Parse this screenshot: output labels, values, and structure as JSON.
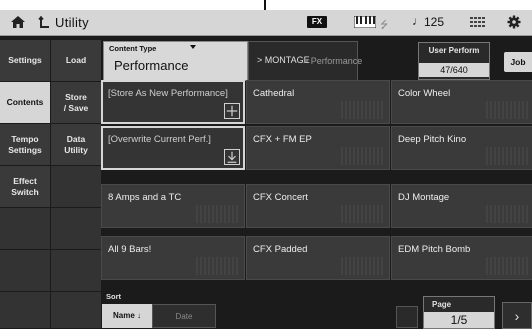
{
  "topbar": {
    "title": "Utility",
    "fx_label": "FX",
    "note_symbol": "♩",
    "tempo": "125"
  },
  "nav": [
    {
      "label": "Settings",
      "active": false
    },
    {
      "label": "Load",
      "active": false
    },
    {
      "label": "Contents",
      "active": true
    },
    {
      "label": "Store\n/ Save",
      "active": false
    },
    {
      "label": "Tempo\nSettings",
      "active": false
    },
    {
      "label": "Data\nUtility",
      "active": false
    },
    {
      "label": "Effect\nSwitch",
      "active": false
    }
  ],
  "content_type": {
    "label": "Content Type",
    "value": "Performance"
  },
  "breadcrumb": {
    "source": "> MONTAGE",
    "target": "> Performance"
  },
  "user_perform": {
    "label": "User Perform",
    "count": "47/640"
  },
  "job_label": "Job",
  "items": [
    [
      "[Store As New Performance]",
      "Cathedral",
      "Color Wheel"
    ],
    [
      "[Overwrite Current Perf.]",
      "CFX + FM EP",
      "Deep Pitch Kino"
    ],
    [
      "8 Amps and a TC",
      "CFX Concert",
      "DJ Montage"
    ],
    [
      "All 9 Bars!",
      "CFX Padded",
      "EDM Pitch Bomb"
    ]
  ],
  "sort": {
    "label": "Sort",
    "name_label": "Name ↓",
    "date_label": "Date"
  },
  "page": {
    "label": "Page",
    "value": "1/5"
  },
  "next_symbol": "›",
  "colors": {
    "active_nav": "#d6d6d6",
    "panel_bg": "#1b1b1b",
    "cell_bg": "#3a3a3a"
  }
}
